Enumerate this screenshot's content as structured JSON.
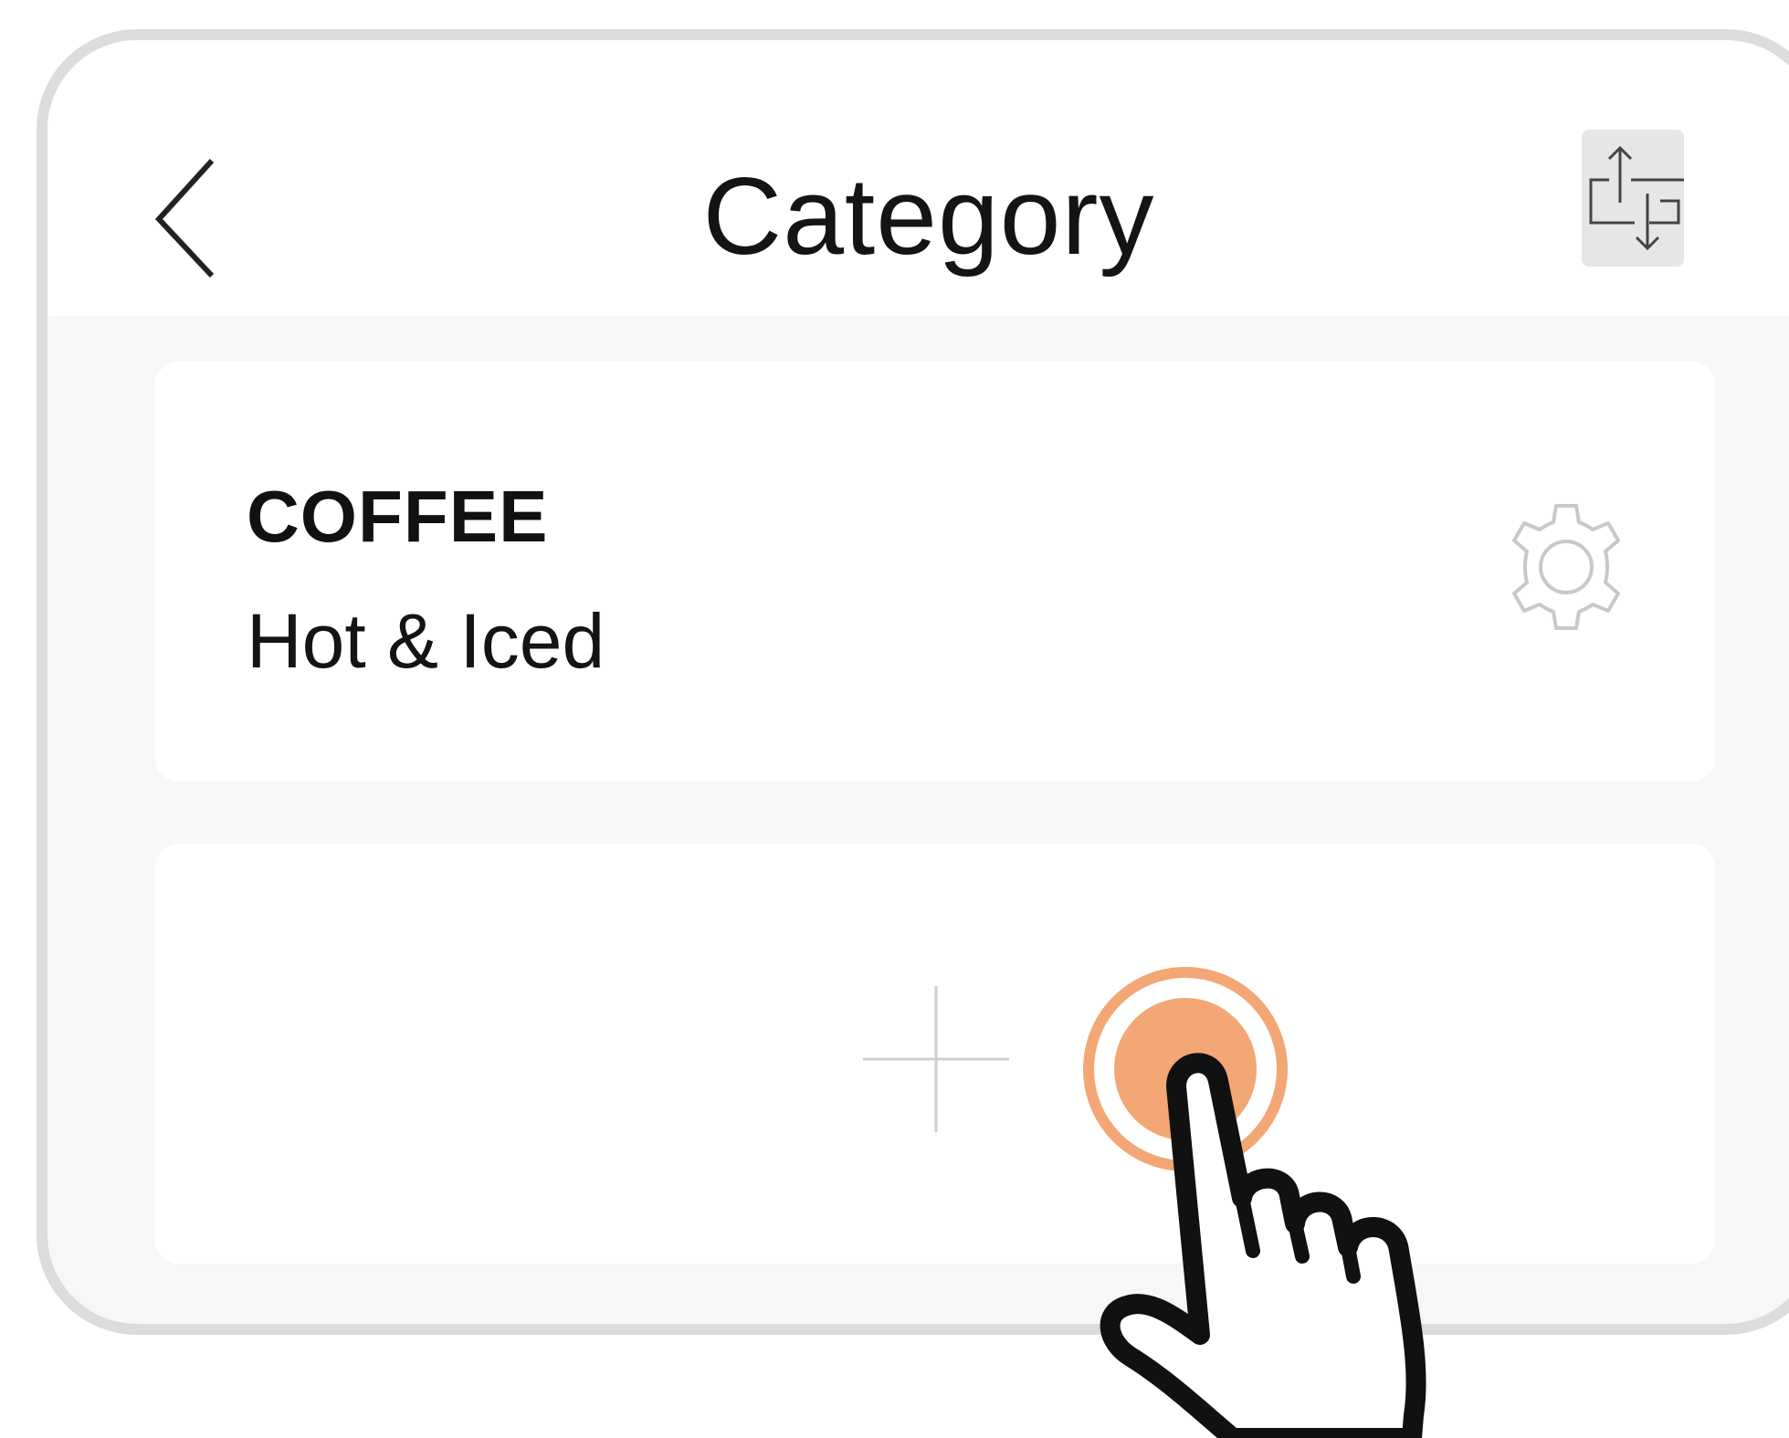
{
  "header": {
    "title": "Category",
    "back_icon": "chevron-left-icon",
    "sort_icon": "reorder-icon"
  },
  "categories": [
    {
      "name": "COFFEE",
      "description": "Hot & Iced",
      "settings_icon": "gear-icon"
    }
  ],
  "add_category": {
    "icon": "plus-icon"
  },
  "overlay": {
    "tap_indicator_color": "#f3a774",
    "hand_icon": "pointing-hand-icon"
  },
  "colors": {
    "frame": "#dcdcdc",
    "background": "#f7f7f7",
    "card": "#ffffff",
    "accent": "#f3a774"
  }
}
